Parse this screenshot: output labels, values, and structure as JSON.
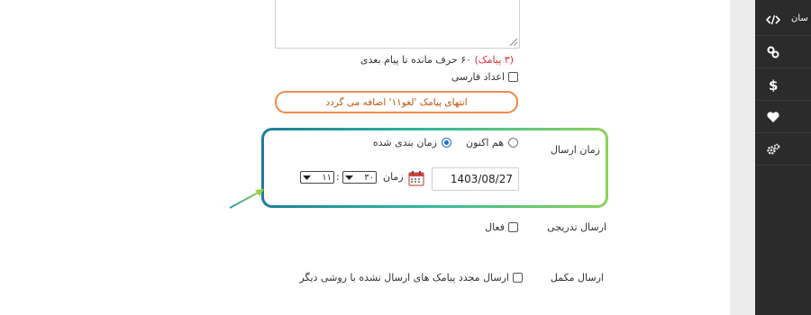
{
  "form": {
    "counter_prefix": "(۳ پیامک)",
    "counter_suffix": " ۶۰ حرف مانده تا پیام بعدی",
    "persian_digits_label": "اعداد فارسی",
    "append_notice": "انتهای پیامک 'لغو۱۱' اضافه می گردد",
    "send_time_label": "زمان ارسال",
    "radio_now_label": "هم اکنون",
    "radio_scheduled_label": "زمان بندی شده",
    "scheduled_selected": true,
    "date_value": "1403/08/27",
    "time_label": "زمان",
    "minute_value": "۳۰",
    "hour_value": "۱۱",
    "colon": ":",
    "gradual_label": "ارسال تدریجی",
    "gradual_option": "فعال",
    "complement_label": "ارسال مکمل",
    "complement_option": "ارسال مجدد پیامک های ارسال نشده با روشی دیگر"
  },
  "sidebar": {
    "items": [
      {
        "icon": "code-icon",
        "label": "سان"
      },
      {
        "icon": "link-icon",
        "label": ""
      },
      {
        "icon": "dollar-icon",
        "label": ""
      },
      {
        "icon": "heart-icon",
        "label": ""
      },
      {
        "icon": "gears-icon",
        "label": ""
      }
    ]
  },
  "colors": {
    "highlight_start": "#1f7c9a",
    "highlight_end": "#8bd35a",
    "notice_border": "#ee8a4a",
    "sidebar_bg": "#2b2b2b",
    "accent_red": "#e03131"
  }
}
